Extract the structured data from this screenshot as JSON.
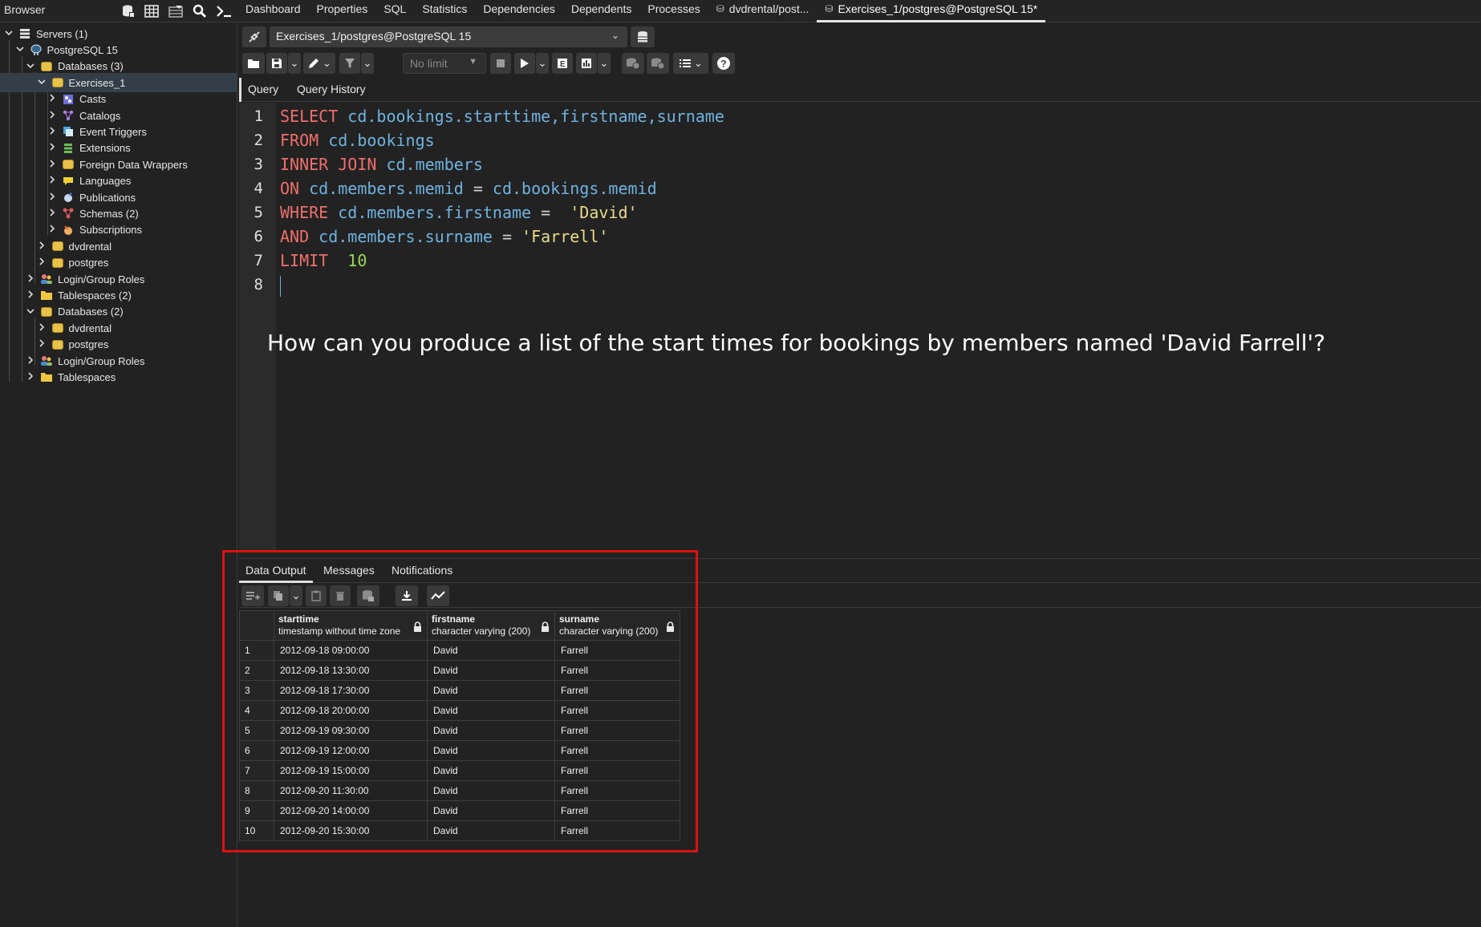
{
  "topbar": {
    "browser_label": "Browser",
    "tabs": [
      {
        "label": "Dashboard"
      },
      {
        "label": "Properties"
      },
      {
        "label": "SQL"
      },
      {
        "label": "Statistics"
      },
      {
        "label": "Dependencies"
      },
      {
        "label": "Dependents"
      },
      {
        "label": "Processes"
      },
      {
        "label": "dvdrental/post..."
      },
      {
        "label": "Exercises_1/postgres@PostgreSQL 15*"
      }
    ],
    "icons": [
      "object-explorer-icon",
      "table-view-icon",
      "filter-rows-icon",
      "search-icon",
      "psql-terminal-icon"
    ]
  },
  "sidebar": {
    "items": [
      {
        "label": "Servers (1)",
        "icon": "servers-icon"
      },
      {
        "label": "PostgreSQL 15",
        "icon": "elephant-icon"
      },
      {
        "label": "Databases (3)",
        "icon": "databases-icon"
      },
      {
        "label": "Exercises_1",
        "icon": "database-icon"
      },
      {
        "label": "Casts",
        "icon": "casts-icon"
      },
      {
        "label": "Catalogs",
        "icon": "catalogs-icon"
      },
      {
        "label": "Event Triggers",
        "icon": "event-triggers-icon"
      },
      {
        "label": "Extensions",
        "icon": "extensions-icon"
      },
      {
        "label": "Foreign Data Wrappers",
        "icon": "foreign-data-wrappers-icon"
      },
      {
        "label": "Languages",
        "icon": "languages-icon"
      },
      {
        "label": "Publications",
        "icon": "publications-icon"
      },
      {
        "label": "Schemas (2)",
        "icon": "schemas-icon"
      },
      {
        "label": "Subscriptions",
        "icon": "subscriptions-icon"
      },
      {
        "label": "dvdrental",
        "icon": "database-icon"
      },
      {
        "label": "postgres",
        "icon": "database-icon"
      },
      {
        "label": "Login/Group Roles",
        "icon": "roles-icon"
      },
      {
        "label": "Tablespaces (2)",
        "icon": "tablespaces-icon"
      },
      {
        "label": "Databases (2)",
        "icon": "databases-icon"
      },
      {
        "label": "dvdrental",
        "icon": "database-icon"
      },
      {
        "label": "postgres",
        "icon": "database-icon"
      },
      {
        "label": "Login/Group Roles",
        "icon": "roles-icon"
      },
      {
        "label": "Tablespaces",
        "icon": "tablespaces-icon"
      }
    ]
  },
  "connection": {
    "label": "Exercises_1/postgres@PostgreSQL 15"
  },
  "toolbar": {
    "limit_label": "No limit"
  },
  "editor_tabs": [
    {
      "label": "Query"
    },
    {
      "label": "Query History"
    }
  ],
  "editor": {
    "line_numbers": [
      "1",
      "2",
      "3",
      "4",
      "5",
      "6",
      "7",
      "8"
    ],
    "lines": [
      [
        {
          "t": "SELECT",
          "c": "kw"
        },
        {
          "t": " cd.bookings.starttime,firstname,surname",
          "c": "id"
        }
      ],
      [
        {
          "t": "FROM",
          "c": "kw"
        },
        {
          "t": " cd.bookings",
          "c": "id"
        }
      ],
      [
        {
          "t": "INNER JOIN",
          "c": "kw"
        },
        {
          "t": " cd.members",
          "c": "id"
        }
      ],
      [
        {
          "t": "ON",
          "c": "kw"
        },
        {
          "t": " cd.members.memid ",
          "c": "id"
        },
        {
          "t": "=",
          "c": "op"
        },
        {
          "t": " cd.bookings.memid",
          "c": "id"
        }
      ],
      [
        {
          "t": "WHERE",
          "c": "kw"
        },
        {
          "t": " cd.members.firstname ",
          "c": "id"
        },
        {
          "t": "=",
          "c": "op"
        },
        {
          "t": "  'David'",
          "c": "str"
        }
      ],
      [
        {
          "t": "AND",
          "c": "kw"
        },
        {
          "t": " cd.members.surname ",
          "c": "id"
        },
        {
          "t": "=",
          "c": "op"
        },
        {
          "t": " 'Farrell'",
          "c": "str"
        }
      ],
      [
        {
          "t": "LIMIT",
          "c": "kw"
        },
        {
          "t": "  10",
          "c": "num"
        }
      ],
      []
    ]
  },
  "question": "How can you produce a list of the start times for bookings by members named 'David Farrell'?",
  "output_tabs": [
    {
      "label": "Data Output"
    },
    {
      "label": "Messages"
    },
    {
      "label": "Notifications"
    }
  ],
  "results": {
    "columns": [
      {
        "name": "starttime",
        "type": "timestamp without time zone"
      },
      {
        "name": "firstname",
        "type": "character varying (200)"
      },
      {
        "name": "surname",
        "type": "character varying (200)"
      }
    ],
    "rows": [
      [
        "1",
        "2012-09-18 09:00:00",
        "David",
        "Farrell"
      ],
      [
        "2",
        "2012-09-18 13:30:00",
        "David",
        "Farrell"
      ],
      [
        "3",
        "2012-09-18 17:30:00",
        "David",
        "Farrell"
      ],
      [
        "4",
        "2012-09-18 20:00:00",
        "David",
        "Farrell"
      ],
      [
        "5",
        "2012-09-19 09:30:00",
        "David",
        "Farrell"
      ],
      [
        "6",
        "2012-09-19 12:00:00",
        "David",
        "Farrell"
      ],
      [
        "7",
        "2012-09-19 15:00:00",
        "David",
        "Farrell"
      ],
      [
        "8",
        "2012-09-20 11:30:00",
        "David",
        "Farrell"
      ],
      [
        "9",
        "2012-09-20 14:00:00",
        "David",
        "Farrell"
      ],
      [
        "10",
        "2012-09-20 15:30:00",
        "David",
        "Farrell"
      ]
    ]
  },
  "colors": {
    "keyword": "#ef6f6c",
    "identifier": "#6fb3e0",
    "string": "#eadb8a",
    "number": "#9bd35a",
    "highlight_box": "#dd1111",
    "selected_row": "#333e48"
  }
}
